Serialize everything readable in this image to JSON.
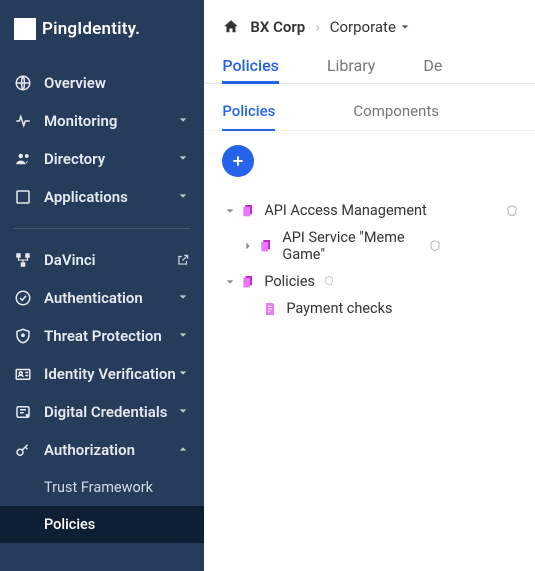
{
  "brand": {
    "label": "PingIdentity."
  },
  "sidebar": {
    "primary": [
      {
        "label": "Overview",
        "icon": "globe",
        "expandable": false
      },
      {
        "label": "Monitoring",
        "icon": "pulse",
        "expandable": true
      },
      {
        "label": "Directory",
        "icon": "users",
        "expandable": true
      },
      {
        "label": "Applications",
        "icon": "square",
        "expandable": true
      }
    ],
    "secondary": [
      {
        "label": "DaVinci",
        "icon": "davinci",
        "external": true
      },
      {
        "label": "Authentication",
        "icon": "check-circle",
        "expandable": true
      },
      {
        "label": "Threat Protection",
        "icon": "shield-star",
        "expandable": true
      },
      {
        "label": "Identity Verification",
        "icon": "id-card",
        "expandable": true
      },
      {
        "label": "Digital Credentials",
        "icon": "badge",
        "expandable": true
      },
      {
        "label": "Authorization",
        "icon": "key",
        "expandable": true,
        "expanded": true,
        "children": [
          {
            "label": "Trust Framework",
            "active": false
          },
          {
            "label": "Policies",
            "active": true
          }
        ]
      }
    ]
  },
  "breadcrumb": {
    "items": [
      {
        "label": "BX Corp",
        "home": true
      },
      {
        "label": "Corporate",
        "dropdown": true
      }
    ]
  },
  "tabs": [
    {
      "label": "Policies",
      "active": true
    },
    {
      "label": "Library",
      "active": false
    },
    {
      "label": "De",
      "active": false
    }
  ],
  "subtabs": [
    {
      "label": "Policies",
      "active": true
    },
    {
      "label": "Components",
      "active": false
    }
  ],
  "tree": [
    {
      "label": "API Access Management",
      "indent": 1,
      "caret": "down",
      "shield": true
    },
    {
      "label": "API Service \"Meme Game\"",
      "indent": 2,
      "caret": "right",
      "shield": true
    },
    {
      "label": "Policies",
      "indent": 1,
      "caret": "down",
      "shield_small": true
    },
    {
      "label": "Payment checks",
      "indent": 3,
      "caret": "none",
      "shield": false
    }
  ]
}
